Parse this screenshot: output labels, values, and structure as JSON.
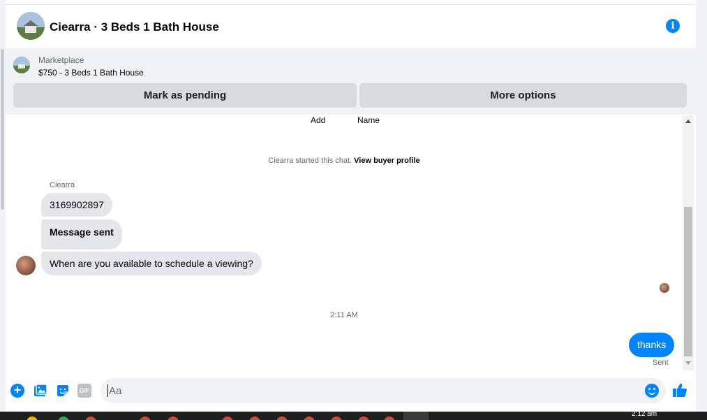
{
  "header": {
    "title": "Ciearra · 3 Beds 1 Bath House",
    "info_icon": "i"
  },
  "listing": {
    "label": "Marketplace",
    "price_title": "$750 - 3 Beds 1 Bath House",
    "buttons": {
      "pending": "Mark as pending",
      "more": "More options"
    }
  },
  "messages": {
    "partial_top": {
      "add": "Add",
      "name": "Name"
    },
    "system": {
      "text": "Ciearra started this chat. ",
      "link": "View buyer profile"
    },
    "sender": "Ciearra",
    "incoming": [
      "3169902897",
      "Message sent",
      "When are you available to schedule a viewing?"
    ],
    "timestamp": "2:11 AM",
    "outgoing": "thanks",
    "status": "Sent"
  },
  "composer": {
    "placeholder": "Aa",
    "gif_label": "GIF"
  },
  "taskbar": {
    "clock": "2:12 am"
  },
  "colors": {
    "accent": "#0084ff",
    "bubble_in": "#e4e6eb",
    "panel": "#f0f2f5"
  }
}
